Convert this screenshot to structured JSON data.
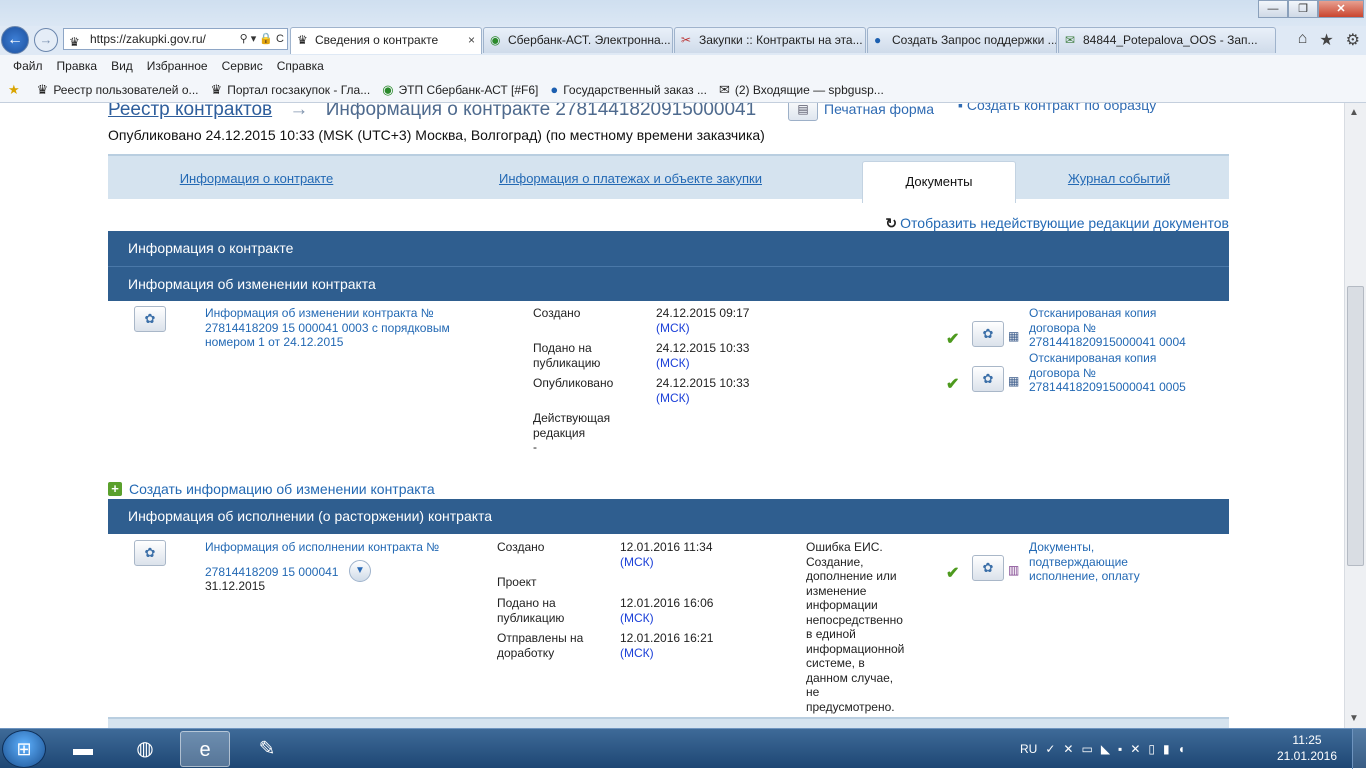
{
  "browser": {
    "address": "https://zakupki.gov.ru/",
    "tabs": [
      {
        "title": "Сведения о контракте",
        "active": true,
        "icon": "russian-emblem-icon"
      },
      {
        "title": "Сбербанк-АСТ. Электронна...",
        "active": false,
        "icon": "sberbank-icon"
      },
      {
        "title": "Закупки :: Контракты на эта...",
        "active": false,
        "icon": "tools-icon"
      },
      {
        "title": "Создать Запрос поддержки ...",
        "active": false,
        "icon": "help-globe-icon"
      },
      {
        "title": "84844_Potepalova_OOS - Зап...",
        "active": false,
        "icon": "mail-icon"
      }
    ],
    "menu": [
      "Файл",
      "Правка",
      "Вид",
      "Избранное",
      "Сервис",
      "Справка"
    ],
    "favorites": [
      {
        "label": "Реестр пользователей о...",
        "icon": "russian-emblem-icon"
      },
      {
        "label": "Портал госзакупок - Гла...",
        "icon": "russian-emblem-icon"
      },
      {
        "label": "ЭТП Сбербанк-АСТ [#F6]",
        "icon": "sberbank-icon"
      },
      {
        "label": "Государственный заказ ...",
        "icon": "globe-icon"
      },
      {
        "label": "(2) Входящие — spbgusp...",
        "icon": "envelope-icon"
      }
    ]
  },
  "page": {
    "breadcrumb_root": "Реестр контрактов",
    "breadcrumb_current": "Информация о контракте 2781441820915000041",
    "print_label": "Печатная форма",
    "create_by_sample": "Создать контракт по образцу",
    "published": "Опубликовано 24.12.2015 10:33 (MSK (UTC+3) Москва, Волгоград) (по местному времени заказчика)",
    "tabs": [
      {
        "label": "Информация о контракте",
        "active": false
      },
      {
        "label": "Информация о платежах и объекте закупки",
        "active": false
      },
      {
        "label": "Документы",
        "active": true
      },
      {
        "label": "Журнал событий",
        "active": false
      }
    ],
    "show_inactive_link": "Отобразить недействующие редакции документов",
    "section_contract_info": "Информация о контракте",
    "section_change_info": "Информация об изменении контракта",
    "change": {
      "doc_link": "Информация об изменении контракта № 27814418209 15 000041 0003 с порядковым номером 1 от 24.12.2015",
      "created_label": "Создано",
      "created_date": "24.12.2015 09:17",
      "submitted_label": "Подано на публикацию",
      "submitted_date": "24.12.2015 10:33",
      "published_label": "Опубликовано",
      "published_date": "24.12.2015 10:33",
      "tz": "(МСК)",
      "current_label": "Действующая редакция",
      "current_value": "-",
      "attachments": [
        "Отсканированая копия договора № 2781441820915000041 0004",
        "Отсканированая копия договора № 2781441820915000041 0005"
      ]
    },
    "create_change_link": "Создать информацию об изменении контракта",
    "section_execution": "Информация об исполнении (о расторжении) контракта",
    "execution": {
      "doc_link_line1": "Информация об исполнении контракта №",
      "doc_link_line2": "27814418209 15 000041",
      "doc_date": "31.12.2015",
      "created_label": "Создано",
      "created_date": "12.01.2016 11:34",
      "tz": "(МСК)",
      "status_label": "Проект",
      "submitted_label": "Подано на публикацию",
      "submitted_date": "12.01.2016 16:06",
      "returned_label": "Отправлены на доработку",
      "returned_date": "12.01.2016 16:21",
      "error_text": "Ошибка ЕИС. Создание, дополнение или изменение информации непосредственно в единой информационной системе, в данном случае, не предусмотрено.",
      "attachment": "Документы, подтверждающие исполнение, оплату"
    }
  },
  "taskbar": {
    "lang": "RU",
    "time": "11:25",
    "date": "21.01.2016"
  }
}
